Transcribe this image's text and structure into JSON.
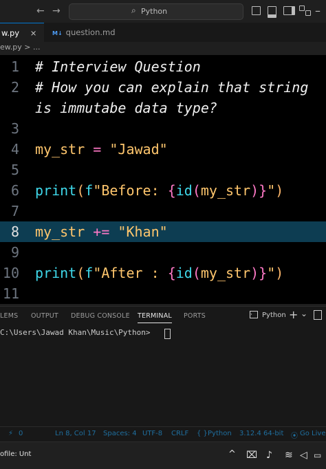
{
  "titlebar": {
    "back": "←",
    "forward": "→",
    "search_label": "Python",
    "search_icon": "search-icon"
  },
  "tabs": [
    {
      "label": "w.py",
      "icon": "close-icon",
      "close": "×"
    },
    {
      "label": "question.md",
      "badge": "M↓"
    }
  ],
  "breadcrumb": "ew.py > ...",
  "editor": {
    "lines": [
      {
        "n": "1",
        "text": "# Interview Question"
      },
      {
        "n": "2",
        "text": "# How you can explain that string"
      },
      {
        "n": "",
        "text": "is immutabe data type?"
      },
      {
        "n": "3",
        "text": ""
      },
      {
        "n": "4",
        "var": "my_str",
        "op": " = ",
        "str": "\"Jawad\""
      },
      {
        "n": "5",
        "text": ""
      },
      {
        "n": "6",
        "fn": "print",
        "p1": "(",
        "f": "f",
        "s1": "\"Before: ",
        "b1": "{",
        "fn2": "id",
        "p2": "(",
        "v": "my_str",
        "p3": ")",
        "b2": "}",
        "s2": "\"",
        "p4": ")"
      },
      {
        "n": "7",
        "text": ""
      },
      {
        "n": "8",
        "var": "my_str",
        "op": " += ",
        "str": "\"Khan\""
      },
      {
        "n": "9",
        "text": ""
      },
      {
        "n": "10",
        "fn": "print",
        "p1": "(",
        "f": "f",
        "s1": "\"After : ",
        "b1": "{",
        "fn2": "id",
        "p2": "(",
        "v": "my_str",
        "p3": ")",
        "b2": "}",
        "s2": "\"",
        "p4": ")"
      },
      {
        "n": "11",
        "text": ""
      }
    ]
  },
  "panel": {
    "tabs": [
      "LEMS",
      "OUTPUT",
      "DEBUG CONSOLE",
      "TERMINAL",
      "PORTS"
    ],
    "active_tab": "TERMINAL",
    "terminal_profile": "Python",
    "add": "+",
    "dropdown": "⌄",
    "terminal_prompt": "C:\\Users\\Jawad Khan\\Music\\Python> "
  },
  "statusbar": {
    "ports": "0",
    "cursor_pos": "Ln 8, Col 17",
    "spaces": "Spaces: 4",
    "encoding": "UTF-8",
    "eol": "CRLF",
    "braces": "{ }",
    "language": "Python",
    "interpreter": "3.12.4 64-bit",
    "golive": "Go Live"
  },
  "taskbar": {
    "profile": "ofile: Unt",
    "chevron": "^"
  }
}
